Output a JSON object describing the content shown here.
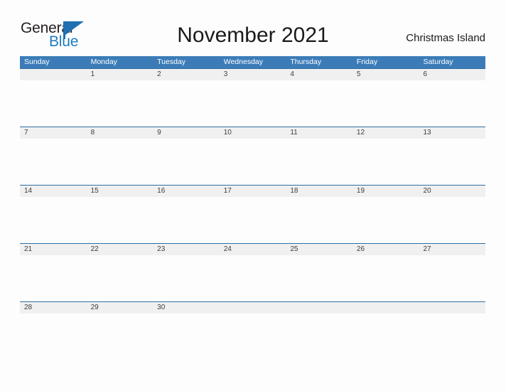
{
  "brand": {
    "name_part1": "General",
    "name_part2": "Blue",
    "flag_color": "#1f6fb2",
    "blue_text_color": "#1f7bc1"
  },
  "header": {
    "title": "November 2021",
    "locale": "Christmas Island"
  },
  "theme": {
    "header_blue": "#3b7cb8",
    "row_line_blue": "#2e6da4",
    "band_gray": "#f0f0f0",
    "page_background": "#fdfdfd",
    "day_number_color": "#3c3c3c"
  },
  "calendar": {
    "month": "November",
    "year": "2021",
    "weekday_headers": [
      "Sunday",
      "Monday",
      "Tuesday",
      "Wednesday",
      "Thursday",
      "Friday",
      "Saturday"
    ],
    "weeks": [
      [
        "",
        "1",
        "2",
        "3",
        "4",
        "5",
        "6"
      ],
      [
        "7",
        "8",
        "9",
        "10",
        "11",
        "12",
        "13"
      ],
      [
        "14",
        "15",
        "16",
        "17",
        "18",
        "19",
        "20"
      ],
      [
        "21",
        "22",
        "23",
        "24",
        "25",
        "26",
        "27"
      ],
      [
        "28",
        "29",
        "30",
        "",
        "",
        "",
        ""
      ]
    ]
  }
}
